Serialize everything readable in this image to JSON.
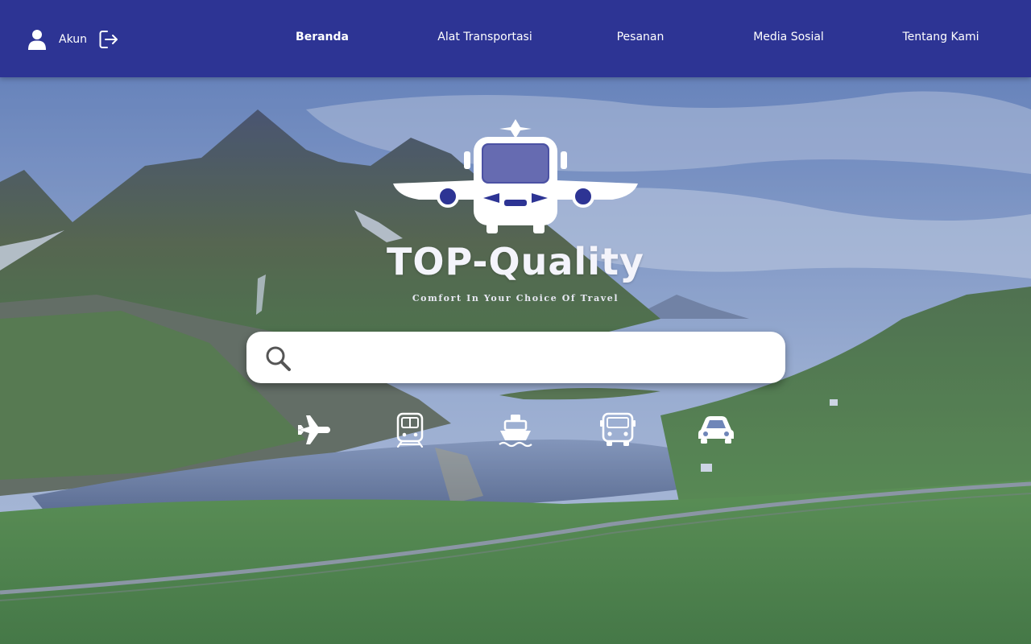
{
  "header": {
    "account_label": "Akun",
    "nav": [
      {
        "label": "Beranda",
        "active": true
      },
      {
        "label": "Alat Transportasi",
        "active": false
      },
      {
        "label": "Pesanan",
        "active": false
      },
      {
        "label": "Media Sosial",
        "active": false
      },
      {
        "label": "Tentang Kami",
        "active": false
      }
    ]
  },
  "brand": {
    "name": "TOP-Quality",
    "tagline": "Comfort In Your Choice Of Travel"
  },
  "search": {
    "placeholder": "",
    "value": ""
  },
  "transport_icons": [
    "airplane-icon",
    "train-icon",
    "ship-icon",
    "bus-icon",
    "car-icon"
  ],
  "colors": {
    "header_bg": "#2d3494",
    "text": "#ffffff"
  }
}
